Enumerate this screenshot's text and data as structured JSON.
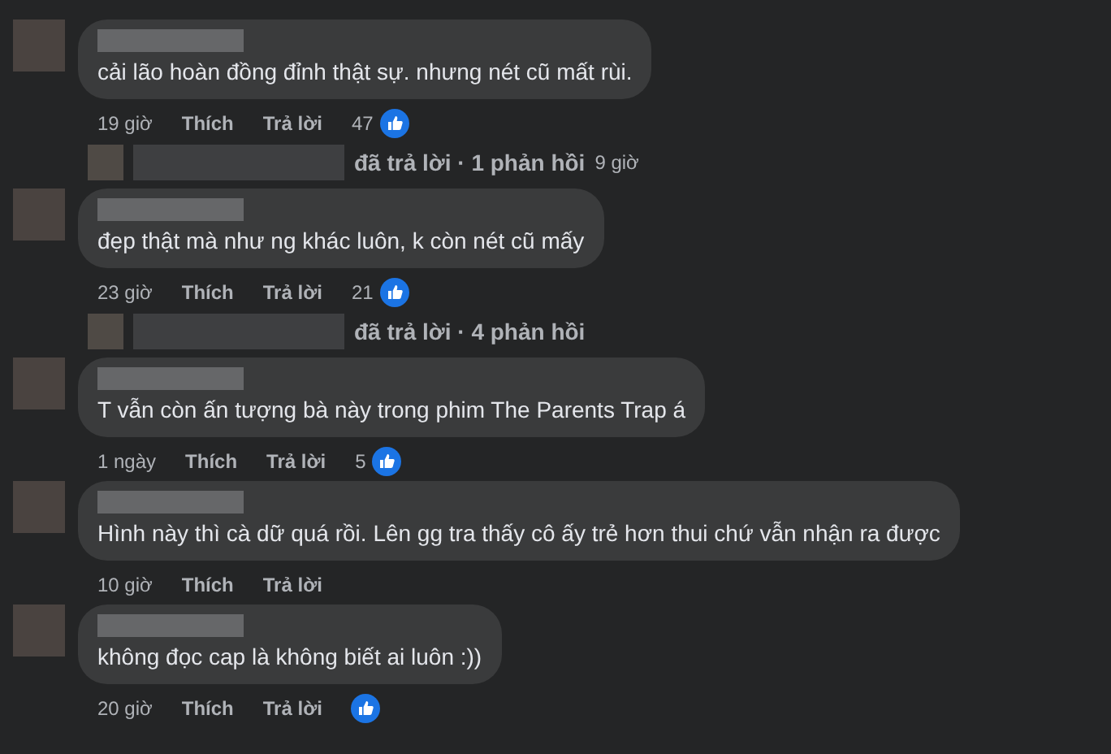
{
  "comments": [
    {
      "text": "cải lão hoàn đồng đỉnh thật sự. nhưng nét cũ mất rùi.",
      "time": "19 giờ",
      "like_label": "Thích",
      "reply_label": "Trả lời",
      "reacted": true,
      "reaction_count": "47",
      "reply_summary": {
        "text": "đã trả lời · 1 phản hồi",
        "time": "9 giờ"
      }
    },
    {
      "text": "đẹp thật mà như ng khác luôn, k còn nét cũ mấy",
      "time": "23 giờ",
      "like_label": "Thích",
      "reply_label": "Trả lời",
      "reacted": true,
      "reaction_count": "21",
      "reply_summary": {
        "text": "đã trả lời · 4 phản hồi"
      }
    },
    {
      "text": "T vẫn còn ấn tượng bà này trong phim The Parents Trap á",
      "time": "1 ngày",
      "like_label": "Thích",
      "reply_label": "Trả lời",
      "reacted": true,
      "reaction_count": "5"
    },
    {
      "text": "Hình này thì cà dữ quá rồi. Lên gg tra thấy cô ấy trẻ hơn thui chứ vẫn nhận ra được",
      "time": "10 giờ",
      "like_label": "Thích",
      "reply_label": "Trả lời",
      "reacted": false
    },
    {
      "text": "không đọc cap là không biết ai luôn :))",
      "time": "20 giờ",
      "like_label": "Thích",
      "reply_label": "Trả lời",
      "reacted": true
    }
  ]
}
